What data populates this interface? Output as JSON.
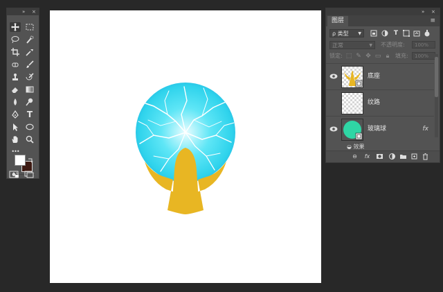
{
  "tools_panel": {
    "collapse_glyph": "»",
    "close_glyph": "×",
    "tools": [
      "move-tool-icon",
      "rect-marquee-icon",
      "lasso-icon",
      "quick-select-icon",
      "crop-icon",
      "eyedropper-icon",
      "healing-icon",
      "brush-icon",
      "clone-stamp-icon",
      "history-brush-icon",
      "eraser-icon",
      "gradient-icon",
      "blur-icon",
      "dodge-icon",
      "pen-icon",
      "type-icon",
      "path-select-icon",
      "ellipse-icon",
      "hand-icon",
      "zoom-icon"
    ],
    "type_tool_label": "T",
    "more_label": "•••",
    "foreground_color": "#ffffff",
    "background_color": "#3d1a12"
  },
  "canvas": {
    "background": "#ffffff",
    "glow_color": "#37d8ef",
    "base_color": "#e8b623"
  },
  "layers_panel": {
    "tab_label": "图层",
    "filter_label": "ρ 类型",
    "blend_mode": "正常",
    "opacity_label": "不透明度:",
    "opacity_value": "100%",
    "lock_label": "锁定:",
    "fill_label": "填充:",
    "fill_value": "100%",
    "layers": [
      {
        "name": "底座",
        "visible": true,
        "fx": ""
      },
      {
        "name": "纹路",
        "visible": false,
        "fx": ""
      },
      {
        "name": "玻璃球",
        "visible": true,
        "fx": "fx"
      }
    ],
    "effects_label": "效果",
    "footer_buttons": [
      "link-icon",
      "fx-icon",
      "mask-icon",
      "adjustment-icon",
      "folder-icon",
      "new-layer-icon",
      "trash-icon"
    ]
  }
}
